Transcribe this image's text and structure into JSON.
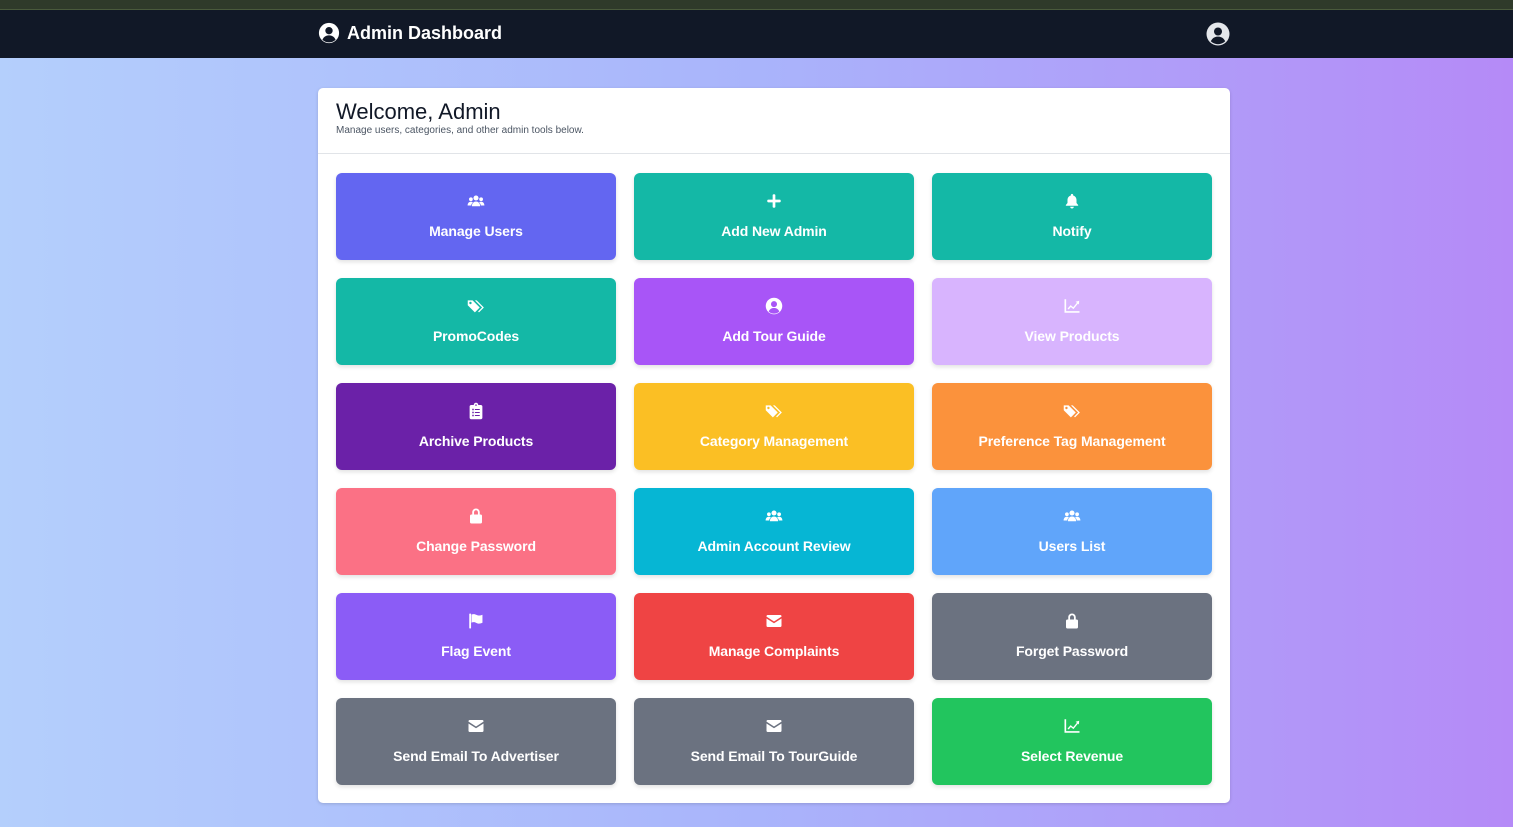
{
  "navbar": {
    "title": "Admin Dashboard",
    "brand_icon": "user-circle-icon",
    "profile_icon": "user-circle-icon"
  },
  "card": {
    "title": "Welcome, Admin",
    "subtitle": "Manage users, categories, and other admin tools below."
  },
  "tiles": [
    {
      "label": "Manage Users",
      "icon": "users-icon",
      "color": "#6366f1"
    },
    {
      "label": "Add New Admin",
      "icon": "plus-icon",
      "color": "#14b8a6"
    },
    {
      "label": "Notify",
      "icon": "bell-icon",
      "color": "#14b8a6"
    },
    {
      "label": "PromoCodes",
      "icon": "tags-icon",
      "color": "#14b8a6"
    },
    {
      "label": "Add Tour Guide",
      "icon": "user-circle-icon",
      "color": "#a855f7"
    },
    {
      "label": "View Products",
      "icon": "chart-line-icon",
      "color": "#d8b4fe"
    },
    {
      "label": "Archive Products",
      "icon": "clipboard-list-icon",
      "color": "#6b21a8"
    },
    {
      "label": "Category Management",
      "icon": "tags-icon",
      "color": "#fbbf24"
    },
    {
      "label": "Preference Tag Management",
      "icon": "tags-icon",
      "color": "#fb923c"
    },
    {
      "label": "Change Password",
      "icon": "lock-icon",
      "color": "#fb7185"
    },
    {
      "label": "Admin Account Review",
      "icon": "users-icon",
      "color": "#06b6d4"
    },
    {
      "label": "Users List",
      "icon": "users-icon",
      "color": "#60a5fa"
    },
    {
      "label": "Flag Event",
      "icon": "flag-icon",
      "color": "#8b5cf6"
    },
    {
      "label": "Manage Complaints",
      "icon": "envelope-icon",
      "color": "#ef4444"
    },
    {
      "label": "Forget Password",
      "icon": "lock-icon",
      "color": "#6b7280"
    },
    {
      "label": "Send Email To Advertiser",
      "icon": "envelope-icon",
      "color": "#6b7280"
    },
    {
      "label": "Send Email To TourGuide",
      "icon": "envelope-icon",
      "color": "#6b7280"
    },
    {
      "label": "Select Revenue",
      "icon": "chart-line-icon",
      "color": "#22c55e"
    }
  ]
}
